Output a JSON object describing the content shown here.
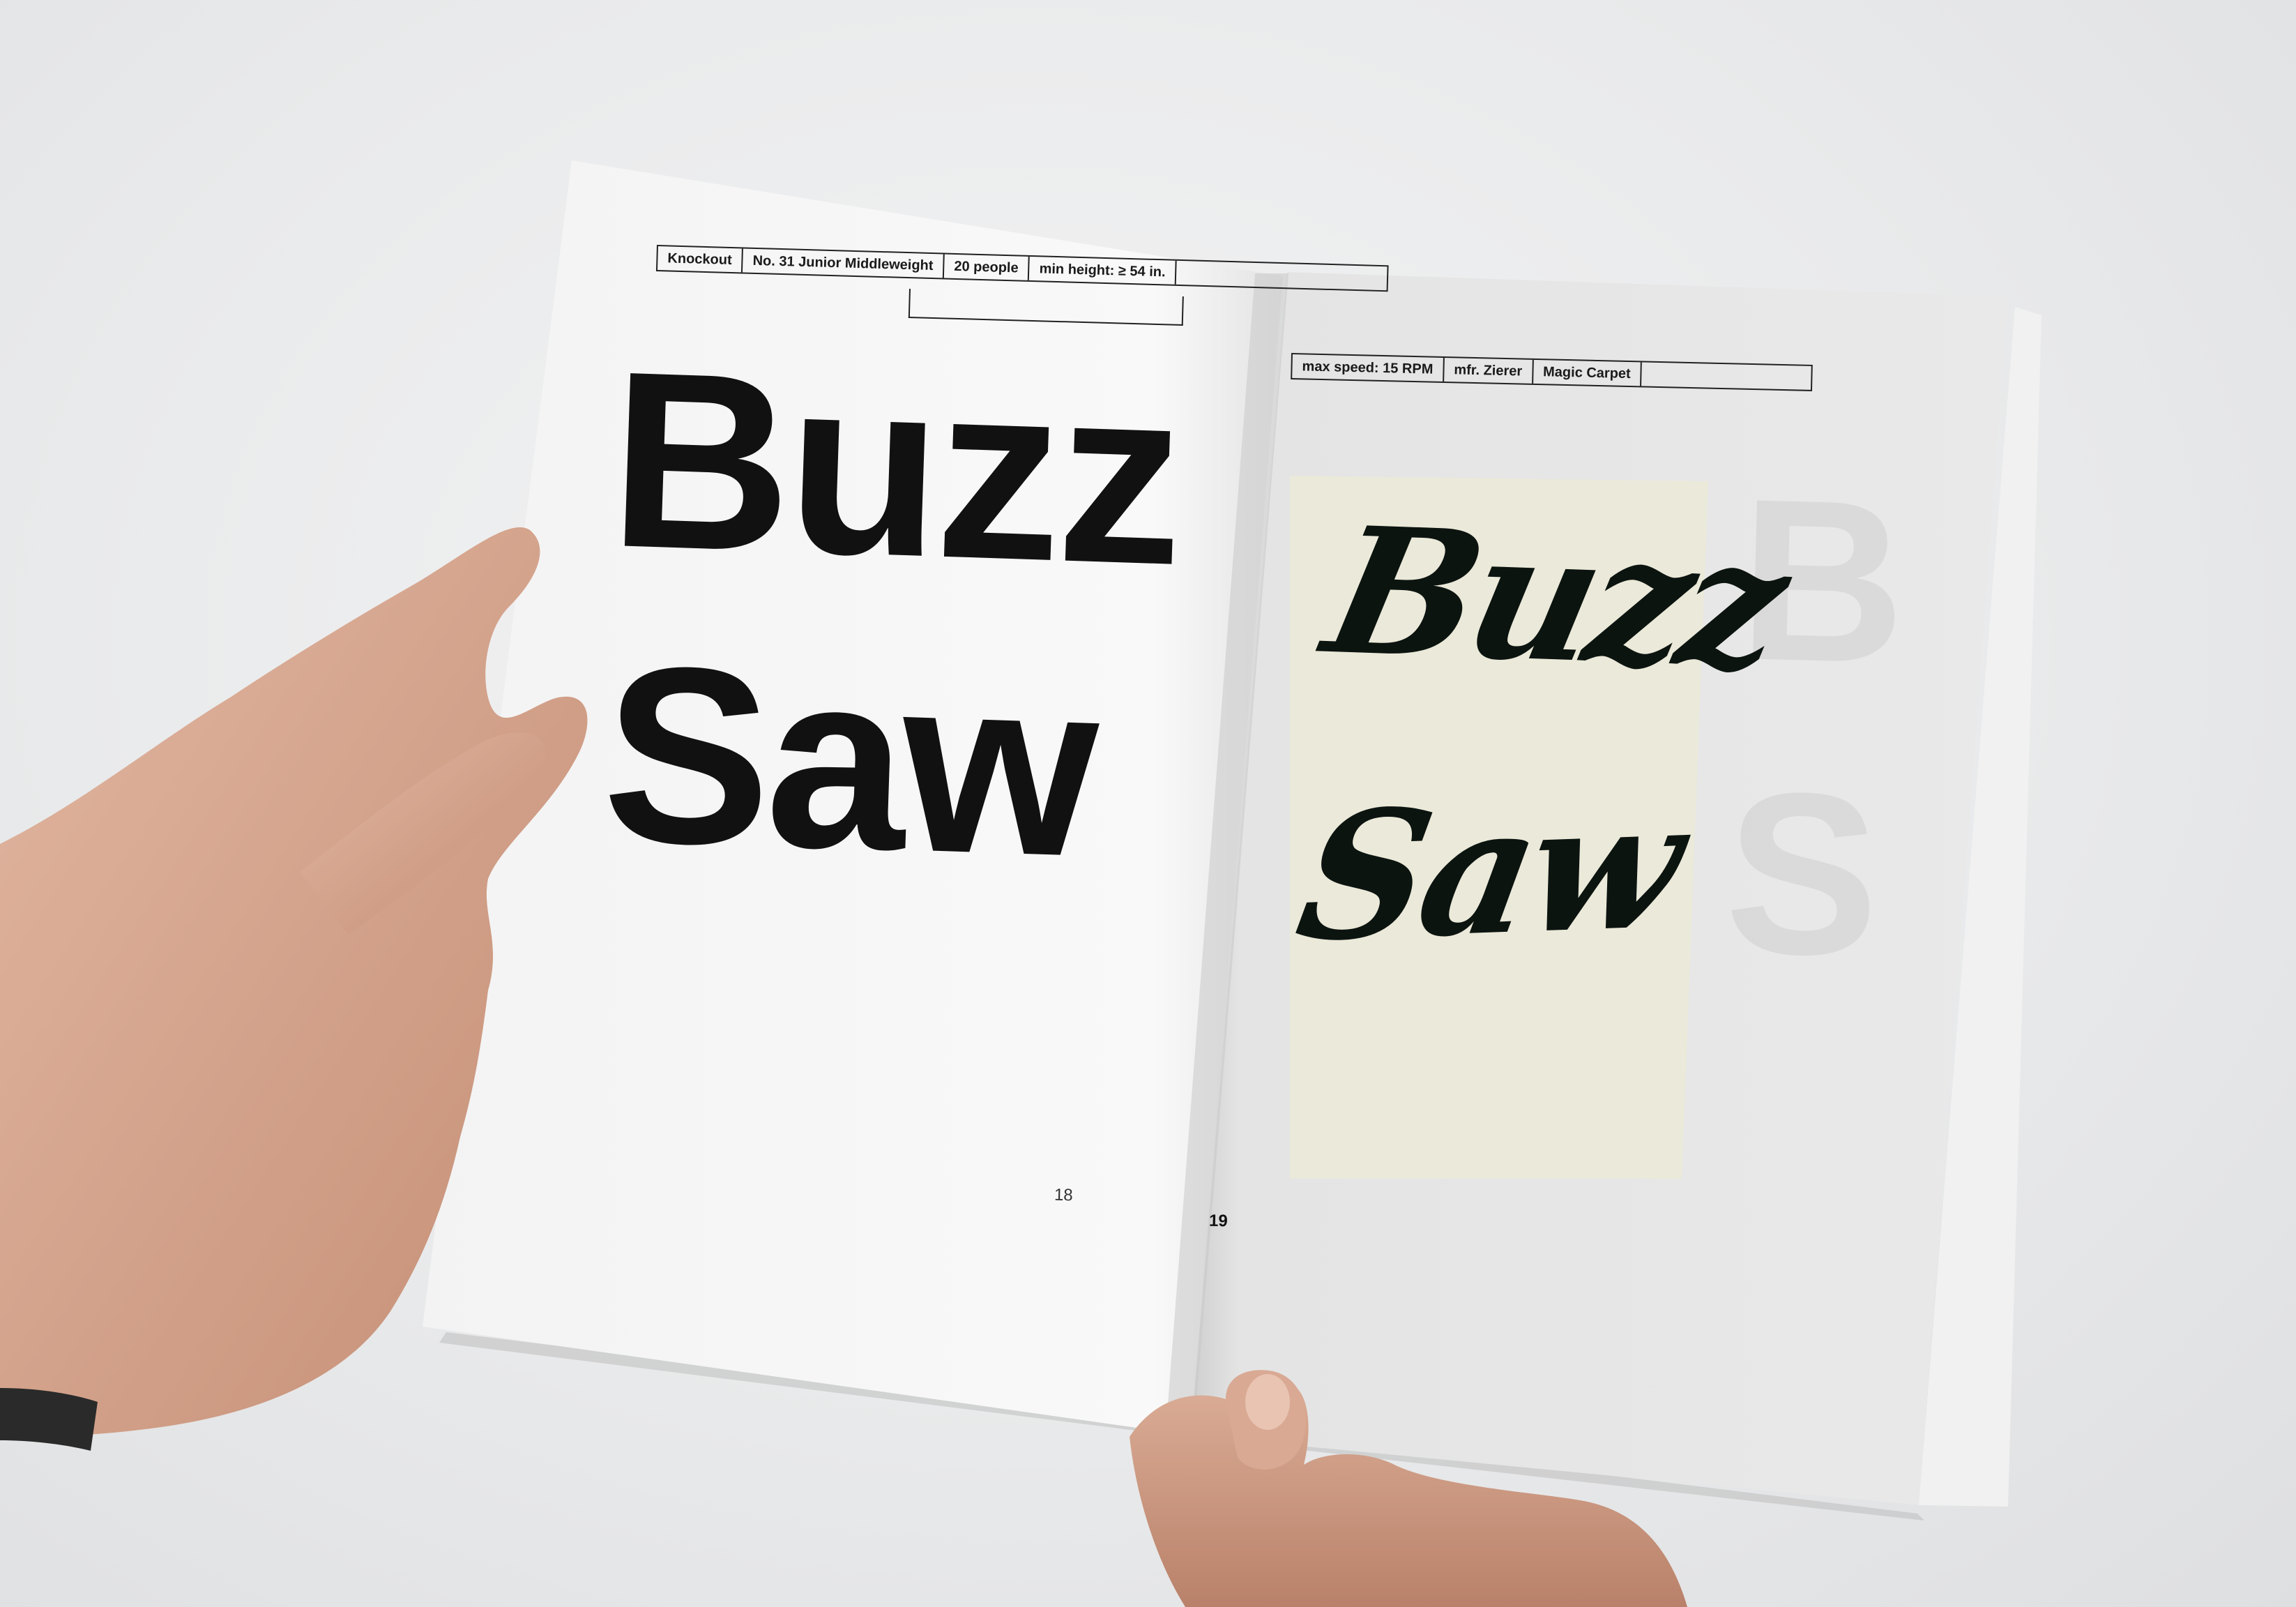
{
  "scene": {
    "description_free": true
  },
  "left_page": {
    "meta": {
      "col1": "Knockout",
      "col2": "No. 31 Junior Middleweight",
      "col3": "20 people",
      "col4": "min height: ≥ 54 in."
    },
    "title_line1": "Buzz",
    "title_line2": "Saw",
    "page_number": "18"
  },
  "right_page": {
    "meta": {
      "col1": "max speed: 15 RPM",
      "col2": "mfr. Zierer",
      "col3": "Magic Carpet"
    },
    "script_line1": "Buzz",
    "script_line2": "Saw",
    "ghost_letter_1": "B",
    "ghost_letter_2": "S",
    "page_number": "19"
  },
  "colors": {
    "background": "#e9eaeb",
    "paper_left": "#f7f7f7",
    "paper_right": "#e6e6e6",
    "ink": "#111111",
    "card": "#ebe9d8",
    "skin": "#d8a790"
  }
}
